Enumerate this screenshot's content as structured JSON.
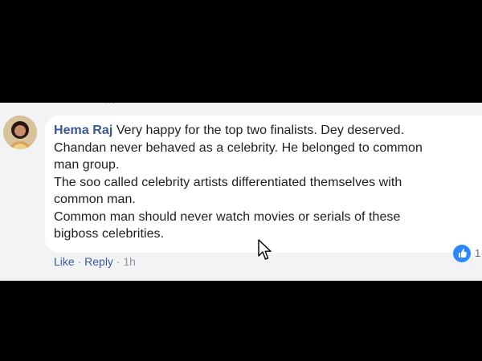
{
  "comment": {
    "author": "Hema Raj",
    "text_lines": [
      "Very happy for the top two finalists. Dey deserved.",
      "Chandan never behaved as a celebrity. He belonged to common",
      "man group.",
      "The soo called celebrity artists differentiated themselves with",
      "common man.",
      "Common man should never watch movies or serials of these",
      "bigboss celebrities."
    ],
    "actions": {
      "like": "Like",
      "reply": "Reply",
      "separator": "·",
      "timestamp": "1h"
    },
    "reaction": {
      "icon": "thumbs-up-icon",
      "count": "1",
      "color": "#2d88ff"
    }
  },
  "theme": {
    "background": "#f2f3f5",
    "bubble": "#ffffff",
    "author_color": "#385898",
    "meta_color": "#8d949e"
  }
}
